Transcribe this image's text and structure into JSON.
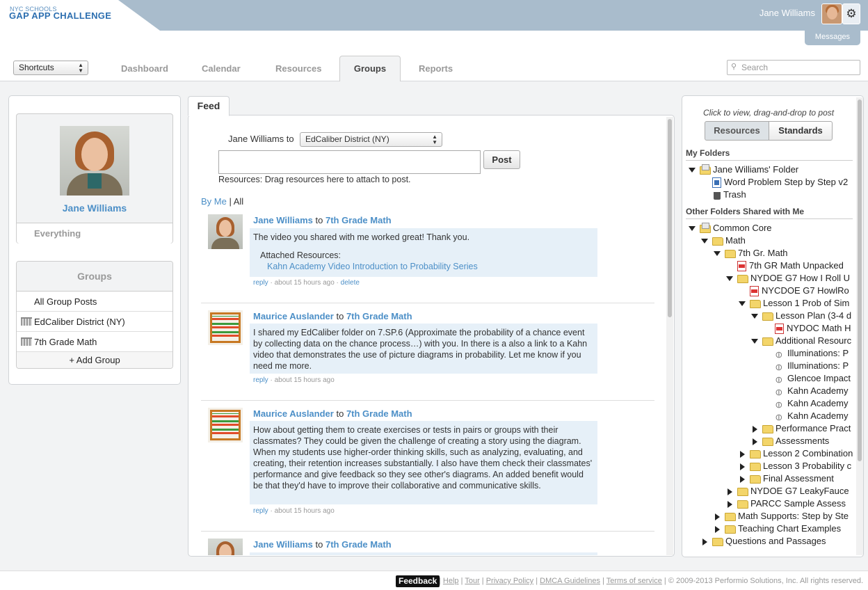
{
  "header": {
    "logo_small": "NYC SCHOOLS",
    "logo_big": "GAP APP CHALLENGE",
    "user_name": "Jane Williams",
    "messages_label": "Messages"
  },
  "nav": {
    "shortcuts_label": "Shortcuts",
    "tabs": [
      "Dashboard",
      "Calendar",
      "Resources",
      "Groups",
      "Reports"
    ],
    "active_tab": "Groups",
    "search_placeholder": "Search"
  },
  "profile": {
    "name": "Jane Williams",
    "everything_label": "Everything"
  },
  "groups": {
    "title": "Groups",
    "items": [
      "All Group Posts",
      "EdCaliber District (NY)",
      "7th Grade Math"
    ],
    "add_label": "+ Add Group"
  },
  "feed": {
    "tab_label": "Feed",
    "poster_label": "Jane Williams to",
    "destination": "EdCaliber District (NY)",
    "post_button": "Post",
    "drag_hint": "Resources: Drag resources here to attach to post.",
    "filter_by_me": "By Me",
    "filter_sep": " | ",
    "filter_all": "All",
    "posts": [
      {
        "author": "Jane Williams",
        "to": "to",
        "group": "7th Grade Math",
        "text": "The video you shared with me worked great! Thank you.",
        "attached_label": "Attached Resources:",
        "attached": "Kahn Academy Video Introduction to Probability Series",
        "reply": "reply",
        "time": " · about 15 hours ago · ",
        "delete": "delete"
      },
      {
        "author": "Maurice Auslander",
        "to": "to",
        "group": "7th Grade Math",
        "text": "I shared my EdCaliber folder on 7.SP.6 (Approximate the probability of a chance event by collecting data on the chance process…) with you.  In there is a also a link to a Kahn video that demonstrates the use of picture diagrams in probability.  Let me know if you need me more.",
        "reply": "reply",
        "time": " · about 15 hours ago"
      },
      {
        "author": "Maurice Auslander",
        "to": "to",
        "group": "7th Grade Math",
        "text": "How about getting them to create exercises or tests in pairs or groups with their classmates?  They could be given the challenge of creating a story using the diagram.  When my students use higher-order thinking skills, such as analyzing, evaluating, and creating, their retention increases substantially.  I also have them check their classmates' performance and give feedback so they see other's diagrams.  An added benefit would be that they'd have to improve their collaborative and communicative skills.",
        "reply": "reply",
        "time": " · about 15 hours ago"
      },
      {
        "author": "Jane Williams",
        "to": "to",
        "group": "7th Grade Math"
      }
    ]
  },
  "resources_panel": {
    "hint": "Click to view, drag-and-drop to post",
    "tab_resources": "Resources",
    "tab_standards": "Standards",
    "my_folders_label": "My Folders",
    "shared_label": "Other Folders Shared with Me",
    "my_tree": [
      "Jane Williams' Folder",
      "Word Problem Step by Step v2",
      "Trash"
    ],
    "shared_tree": [
      "Common Core",
      "Math",
      "7th Gr. Math",
      "7th GR Math Unpacked",
      "NYDOE G7 How I Roll U",
      "NYCDOE G7 HowlRo",
      "Lesson 1 Prob of Sim",
      "Lesson Plan (3-4 d",
      "NYDOC Math H",
      "Additional Resourc",
      "Illuminations: P",
      "Illuminations: P",
      "Glencoe Impact",
      "Kahn Academy",
      "Kahn Academy",
      "Kahn Academy",
      "Performance Pract",
      "Assessments",
      "Lesson 2 Combination",
      "Lesson 3 Probability c",
      "Final Assessment",
      "NYDOE G7 LeakyFauce",
      "PARCC Sample Assess",
      "Math Supports: Step by Ste",
      "Teaching Chart Examples",
      "Questions and Passages"
    ]
  },
  "footer": {
    "feedback": "Feedback",
    "links": [
      "Help",
      "Tour",
      "Privacy Policy",
      "DMCA Guidelines",
      "Terms of service"
    ],
    "copyright": "© 2009-2013 Performio Solutions, Inc. All rights reserved."
  }
}
